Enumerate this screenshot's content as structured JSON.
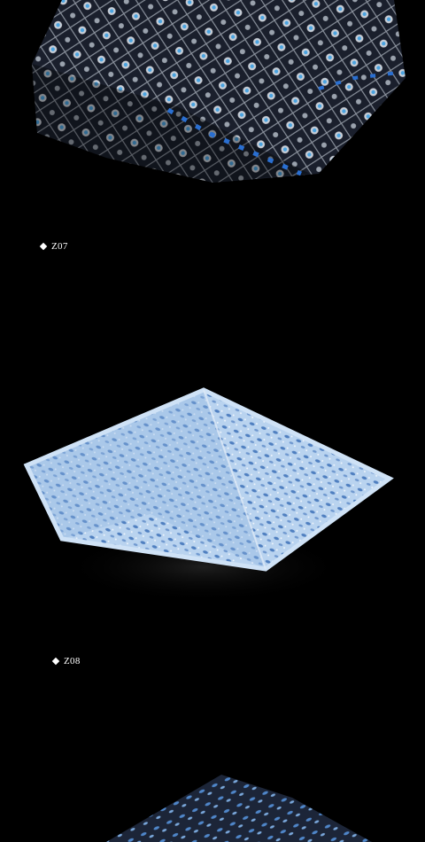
{
  "products": [
    {
      "code": "Z07",
      "pattern": "navy-silver-blue-floral-lattice"
    },
    {
      "code": "Z08",
      "pattern": "light-blue-paisley-speckle"
    },
    {
      "code": "",
      "pattern": "navy-blue-leaf-speckle-partial"
    }
  ],
  "colors": {
    "background": "#000000",
    "caption_text": "#ffffff",
    "z07_base": "#1a1f2c",
    "z07_accent": "#4aa3e0",
    "z07_silver": "#c9ced6",
    "z08_base": "#a9c8ea",
    "z08_dark": "#4f7fc0",
    "z09_base": "#1c2538"
  },
  "icons": {
    "caption_bullet": "diamond-icon"
  }
}
